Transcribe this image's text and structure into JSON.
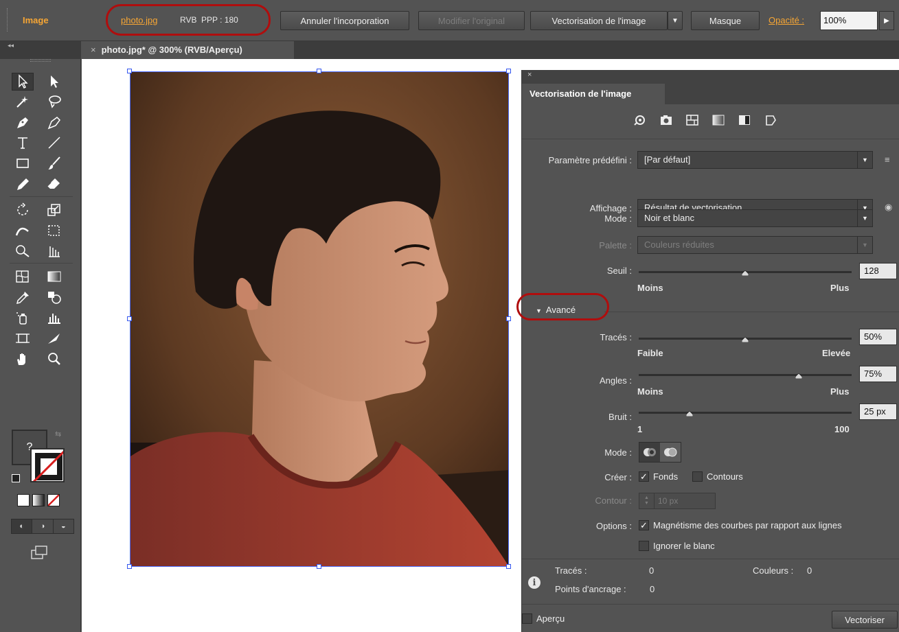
{
  "control_bar": {
    "context_label": "Image",
    "file_name": "photo.jpg",
    "color_mode": "RVB",
    "ppi": "PPP : 180",
    "unembed_label": "Annuler l'incorporation",
    "edit_original_label": "Modifier l'original",
    "image_trace_label": "Vectorisation de l'image",
    "mask_label": "Masque",
    "opacity_label": "Opacité :",
    "opacity_value": "100%"
  },
  "document_tab": {
    "title": "photo.jpg* @ 300% (RVB/Aperçu)",
    "close_symbol": "×"
  },
  "tools": {
    "fill_unknown": "?"
  },
  "trace_panel": {
    "title": "Vectorisation de l'image",
    "preset_label": "Paramètre prédéfini :",
    "preset_value": "[Par défaut]",
    "view_label": "Affichage :",
    "view_value": "Résultat de vectorisation",
    "mode_label": "Mode :",
    "mode_value": "Noir et blanc",
    "palette_label": "Palette :",
    "palette_value": "Couleurs réduites",
    "threshold": {
      "label": "Seuil :",
      "value": "128",
      "level": 0.5,
      "min_label": "Moins",
      "max_label": "Plus"
    },
    "advanced_label": "Avancé",
    "paths": {
      "label": "Tracés :",
      "value": "50%",
      "level": 0.5,
      "min_label": "Faible",
      "max_label": "Elevée"
    },
    "corners": {
      "label": "Angles :",
      "value": "75%",
      "level": 0.75,
      "min_label": "Moins",
      "max_label": "Plus"
    },
    "noise": {
      "label": "Bruit :",
      "value": "25 px",
      "level": 0.24,
      "min_label": "1",
      "max_label": "100"
    },
    "method_label": "Mode :",
    "create_label": "Créer :",
    "fills_label": "Fonds",
    "fills_checked": true,
    "strokes_label": "Contours",
    "strokes_checked": false,
    "stroke_label": "Contour :",
    "stroke_value": "10 px",
    "options_label": "Options :",
    "snap_curves_label": "Magnétisme des courbes par rapport aux lignes",
    "snap_curves_checked": true,
    "ignore_white_label": "Ignorer le blanc",
    "ignore_white_checked": false,
    "info": {
      "paths_label": "Tracés :",
      "paths_value": "0",
      "colors_label": "Couleurs :",
      "colors_value": "0",
      "anchors_label": "Points d'ancrage :",
      "anchors_value": "0"
    },
    "preview_label": "Aperçu",
    "preview_checked": false,
    "trace_button_label": "Vectoriser"
  },
  "colors": {
    "accent_orange": "#f7a634",
    "annotation_red": "#b00d0d",
    "panel_bg": "#535353",
    "selection_blue": "#3355ee"
  }
}
